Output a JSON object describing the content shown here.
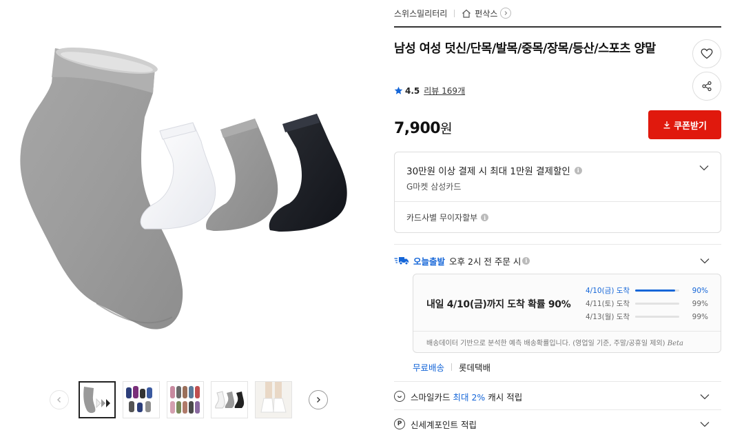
{
  "seller": {
    "name": "스위스밀리터리",
    "store_link": "펀삭스"
  },
  "product": {
    "title": "남성 여성 덧신/단목/발목/중목/장목/등산/스포츠 양말",
    "rating": "4.5",
    "review_label": "리뷰 169개",
    "price": "7,900",
    "price_unit": "원"
  },
  "coupon_button": "쿠폰받기",
  "discount": {
    "headline": "30만원 이상 결제 시 최대 1만원 결제할인",
    "card": "G마켓 삼성카드",
    "installment": "카드사별 무이자할부"
  },
  "shipping": {
    "badge": "오늘출발",
    "cutoff": "오후 2시 전 주문 시",
    "prediction_headline": "내일 4/10(금)까지 도착 확률 90%",
    "predictions": [
      {
        "date": "4/10(금) 도착",
        "pct": "90%",
        "value": 90
      },
      {
        "date": "4/11(토) 도착",
        "pct": "99%",
        "value": 99
      },
      {
        "date": "4/13(월) 도착",
        "pct": "99%",
        "value": 99
      }
    ],
    "note": "배송데이터 기반으로 분석한 예측 배송확률입니다. (영업일 기준, 주말/공휴일 제외)",
    "note_beta": "Beta",
    "free_label": "무료배송",
    "courier": "롯데택배"
  },
  "benefits": {
    "smile_prefix": "스마일카드",
    "smile_highlight": "최대 2%",
    "smile_suffix": "캐시 적립",
    "shinsegae": "신세계포인트 적립"
  },
  "gallery": {
    "thumbnail_count": 5,
    "active_index": 0
  },
  "colors": {
    "accent_blue": "#1566d8",
    "coupon_red": "#e0190d"
  }
}
